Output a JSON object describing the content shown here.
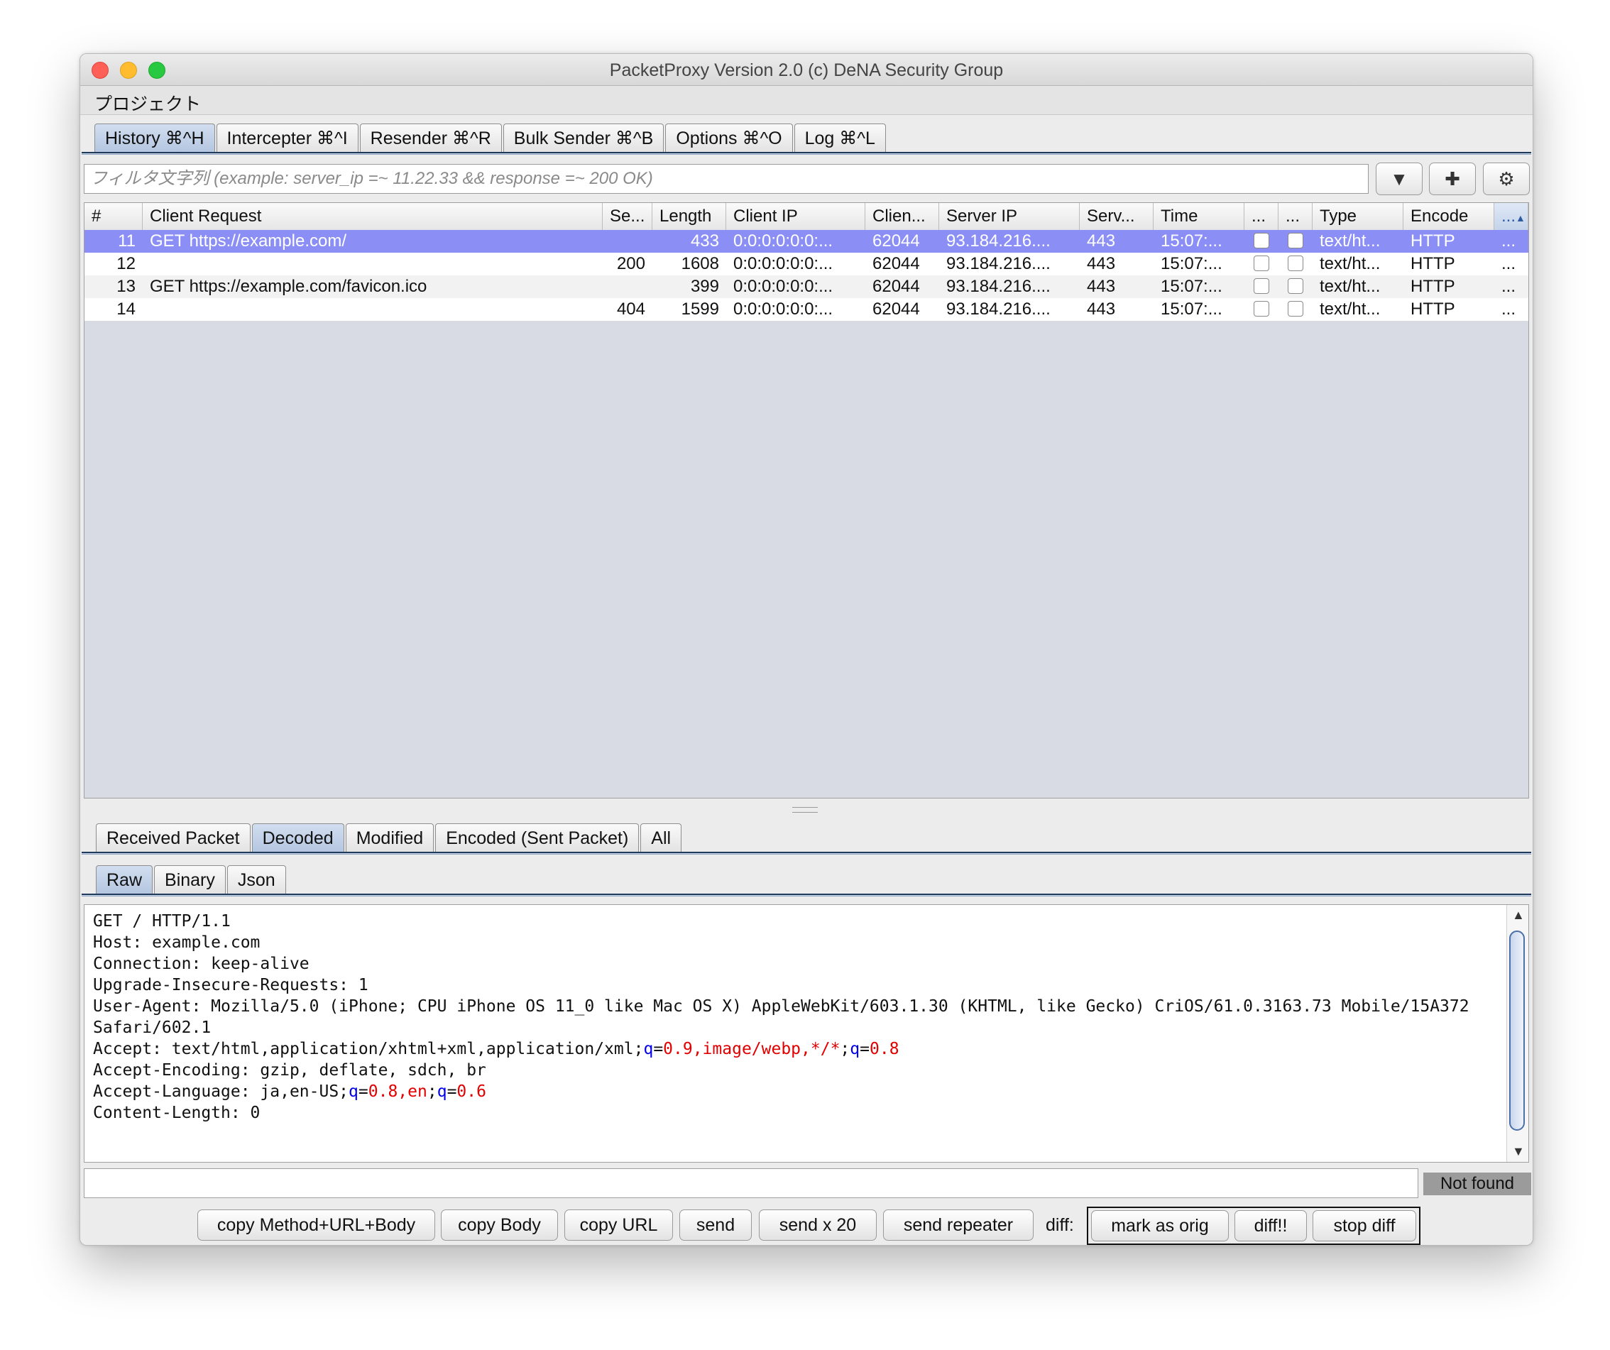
{
  "window": {
    "title": "PacketProxy Version 2.0 (c) DeNA Security Group"
  },
  "menubar": {
    "items": [
      "プロジェクト"
    ]
  },
  "main_tabs": [
    {
      "label": "History ⌘^H",
      "active": true
    },
    {
      "label": "Intercepter ⌘^I"
    },
    {
      "label": "Resender ⌘^R"
    },
    {
      "label": "Bulk Sender ⌘^B"
    },
    {
      "label": "Options ⌘^O"
    },
    {
      "label": "Log ⌘^L"
    }
  ],
  "filter": {
    "placeholder": "フィルタ文字列   (example: server_ip =~ 11.22.33 && response =~ 200 OK)"
  },
  "toolbar_icons": [
    "chevron-down-icon",
    "plus-icon",
    "gear-icon"
  ],
  "table": {
    "headers": [
      "#",
      "Client Request",
      "Se...",
      "Length",
      "Client IP",
      "Clien...",
      "Server IP",
      "Serv...",
      "Time",
      "...",
      "...",
      "Type",
      "Encode",
      "..."
    ],
    "rows": [
      {
        "id": "11",
        "request": "GET https://example.com/",
        "status": "",
        "length": "433",
        "client_ip": "0:0:0:0:0:0:...",
        "client_port": "62044",
        "server_ip": "93.184.216....",
        "server_port": "443",
        "time": "15:07:...",
        "type": "text/ht...",
        "encode": "HTTP",
        "more": "...",
        "selected": true
      },
      {
        "id": "12",
        "request": "",
        "status": "200",
        "length": "1608",
        "client_ip": "0:0:0:0:0:0:...",
        "client_port": "62044",
        "server_ip": "93.184.216....",
        "server_port": "443",
        "time": "15:07:...",
        "type": "text/ht...",
        "encode": "HTTP",
        "more": "..."
      },
      {
        "id": "13",
        "request": "GET https://example.com/favicon.ico",
        "status": "",
        "length": "399",
        "client_ip": "0:0:0:0:0:0:...",
        "client_port": "62044",
        "server_ip": "93.184.216....",
        "server_port": "443",
        "time": "15:07:...",
        "type": "text/ht...",
        "encode": "HTTP",
        "more": "..."
      },
      {
        "id": "14",
        "request": "",
        "status": "404",
        "length": "1599",
        "client_ip": "0:0:0:0:0:0:...",
        "client_port": "62044",
        "server_ip": "93.184.216....",
        "server_port": "443",
        "time": "15:07:...",
        "type": "text/ht...",
        "encode": "HTTP",
        "more": "..."
      }
    ]
  },
  "packet_tabs": [
    {
      "label": "Received Packet"
    },
    {
      "label": "Decoded",
      "active": true
    },
    {
      "label": "Modified"
    },
    {
      "label": "Encoded (Sent Packet)"
    },
    {
      "label": "All"
    }
  ],
  "view_tabs": [
    {
      "label": "Raw",
      "active": true
    },
    {
      "label": "Binary"
    },
    {
      "label": "Json"
    }
  ],
  "raw": {
    "line1": "GET / HTTP/1.1",
    "line2": "Host: example.com",
    "line3": "Connection: keep-alive",
    "line4": "Upgrade-Insecure-Requests: 1",
    "line5": "User-Agent: Mozilla/5.0 (iPhone; CPU iPhone OS 11_0 like Mac OS X) AppleWebKit/603.1.30 (KHTML, like Gecko) CriOS/61.0.3163.73 Mobile/15A372",
    "line6": "Safari/602.1",
    "accept_prefix": "Accept: text/html,application/xhtml+xml,application/xml;",
    "accept_q1": "q",
    "accept_eq1": "=",
    "accept_v1": "0.9,image/webp,*/*",
    "accept_semi": ";",
    "accept_q2": "q",
    "accept_eq2": "=",
    "accept_v2": "0.8",
    "line8": "Accept-Encoding: gzip, deflate, sdch, br",
    "lang_prefix": "Accept-Language: ja,en-US;",
    "lang_q1": "q",
    "lang_eq1": "=",
    "lang_v1": "0.8,en",
    "lang_semi": ";",
    "lang_q2": "q",
    "lang_eq2": "=",
    "lang_v2": "0.6",
    "line10": "Content-Length: 0"
  },
  "search": {
    "value": "",
    "status": "Not found"
  },
  "actions": {
    "copy_method_url_body": "copy Method+URL+Body",
    "copy_body": "copy Body",
    "copy_url": "copy URL",
    "send": "send",
    "send_x20": "send x 20",
    "send_repeater": "send repeater",
    "diff_label": "diff:",
    "mark_as_orig": "mark as orig",
    "diff": "diff!!",
    "stop_diff": "stop diff"
  },
  "colors": {
    "selected_row": "#8b8ff5",
    "syntax_key": "#0000ee",
    "syntax_value": "#e20000",
    "accent": "#203a5c"
  }
}
